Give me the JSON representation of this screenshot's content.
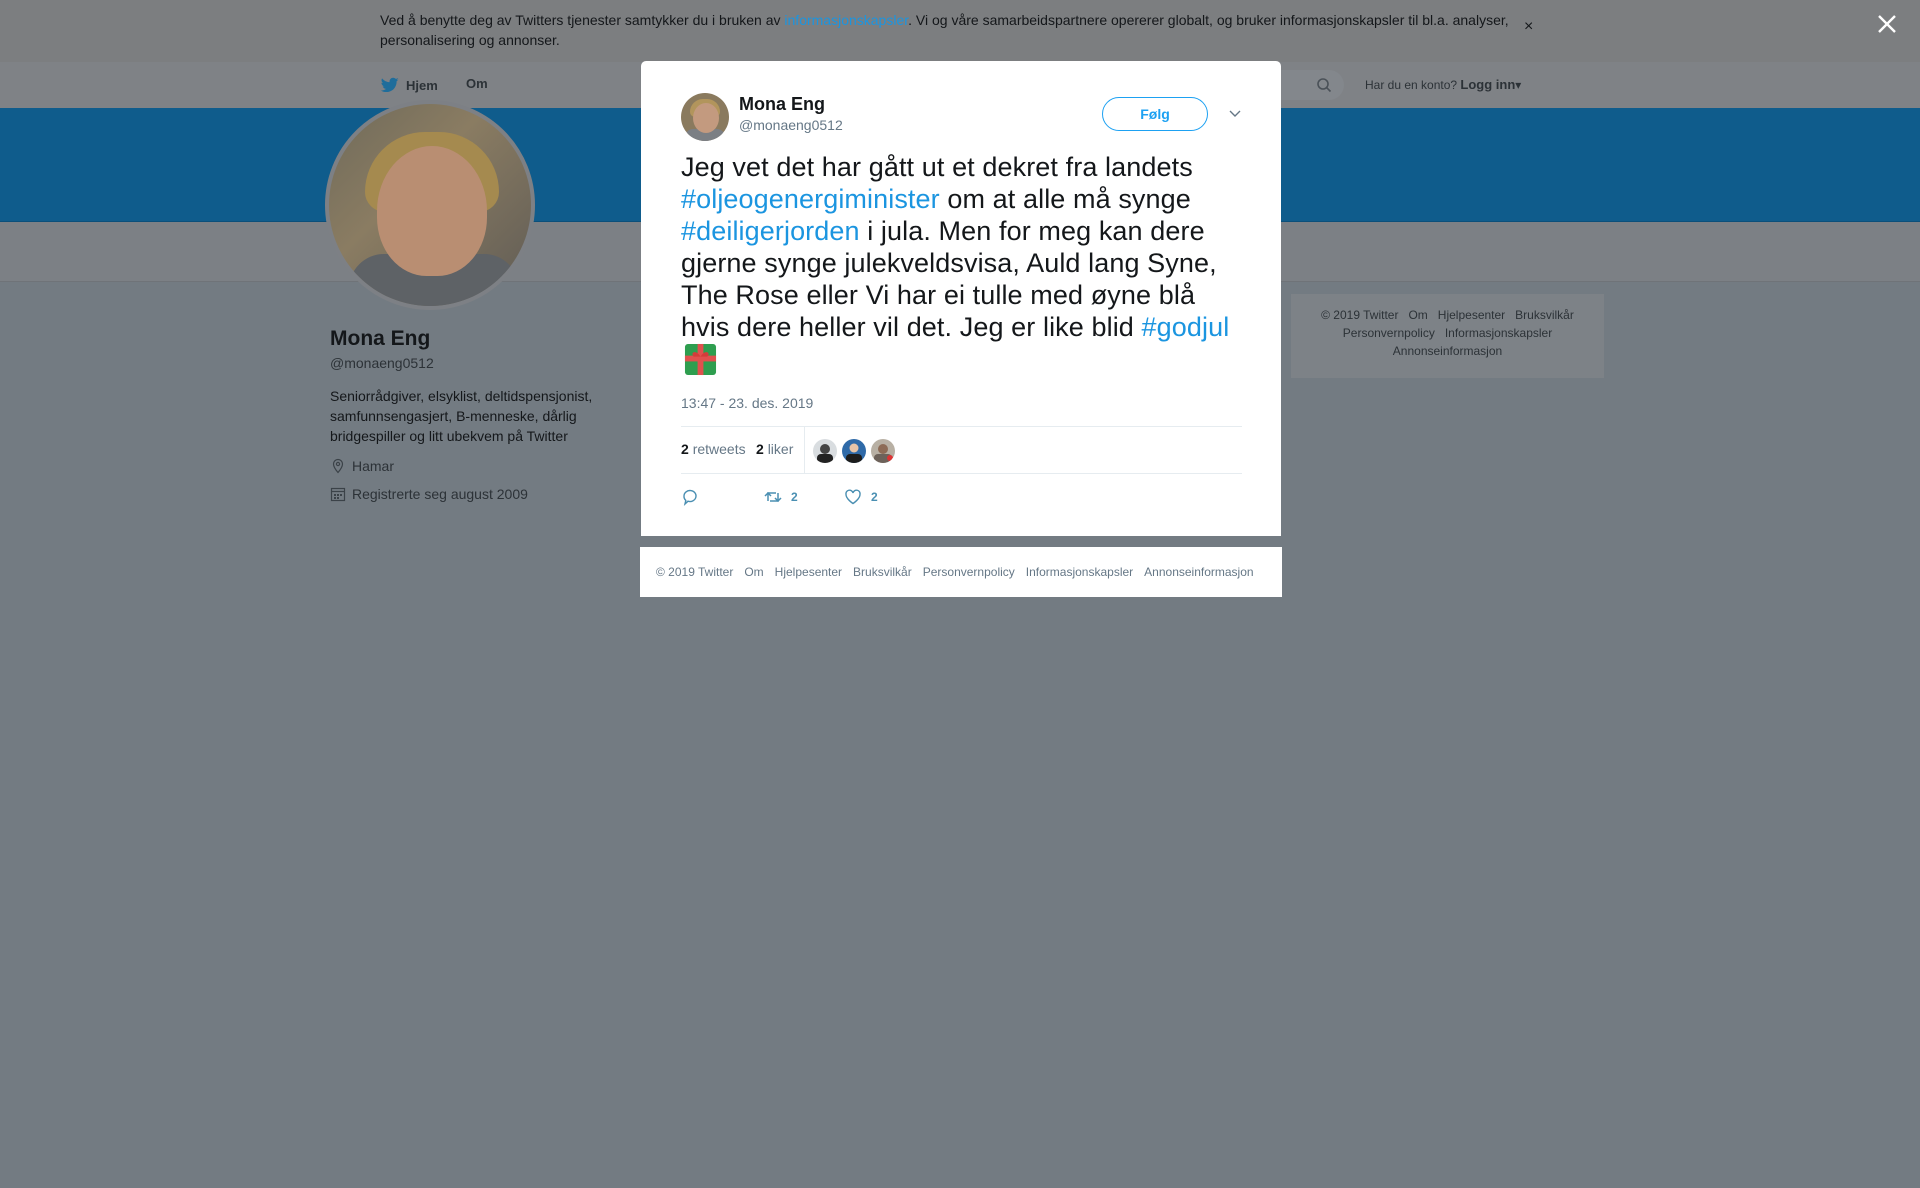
{
  "cookie_banner": {
    "text_before": "Ved å benytte deg av Twitters tjenester samtykker du i bruken av ",
    "link": "informasjonskapsler",
    "text_after": ". Vi og våre samarbeidspartnere opererer globalt, og bruker informasjonskapsler til bl.a. analyser, personalisering og annonser.",
    "close": "×"
  },
  "nav": {
    "home": "Hjem",
    "about": "Om",
    "has_account": "Har du en konto?",
    "login": "Logg inn"
  },
  "profile": {
    "name": "Mona Eng",
    "handle": "@monaeng0512",
    "bio": "Seniorrådgiver, elsyklist, deltidspensjonist, samfunnsengasjert, B-menneske, dårlig bridgespiller og litt ubekvem på Twitter",
    "location": "Hamar",
    "joined": "Registrerte seg august 2009"
  },
  "side_footer": {
    "items": [
      "© 2019 Twitter",
      "Om",
      "Hjelpesenter",
      "Bruksvilkår",
      "Personvernpolicy",
      "Informasjonskapsler",
      "Annonseinformasjon"
    ]
  },
  "tweet": {
    "author_name": "Mona Eng",
    "author_handle": "@monaeng0512",
    "follow_label": "Følg",
    "text_1": "Jeg vet det har gått ut et dekret fra landets ",
    "hashtag_1": "#oljeogenergiminister",
    "text_2": " om at alle må synge ",
    "hashtag_2": "#deiligerjorden",
    "text_3": " i jula. Men for meg kan dere gjerne synge julekveldsvisa, Auld lang Syne, The Rose eller Vi har ei tulle med øyne blå hvis dere heller vil det. Jeg er like blid ",
    "hashtag_3": "#godjul",
    "timestamp": "13:47 - 23. des. 2019",
    "retweets_count": "2",
    "retweets_label": "retweets",
    "likes_count": "2",
    "likes_label": "liker",
    "action_retweet_count": "2",
    "action_like_count": "2"
  },
  "modal_footer": {
    "items": [
      "© 2019 Twitter",
      "Om",
      "Hjelpesenter",
      "Bruksvilkår",
      "Personvernpolicy",
      "Informasjonskapsler",
      "Annonseinformasjon"
    ]
  },
  "colors": {
    "link_blue": "#1b95e0",
    "twitter_blue": "#1da1f2",
    "overlay_gray": "#737b82",
    "banner_blue": "#0f5c8c"
  },
  "icons": [
    "twitter-bird-icon",
    "search-icon",
    "location-icon",
    "calendar-icon",
    "chevron-down-icon",
    "reply-icon",
    "retweet-icon",
    "heart-icon",
    "gift-icon",
    "close-icon"
  ]
}
